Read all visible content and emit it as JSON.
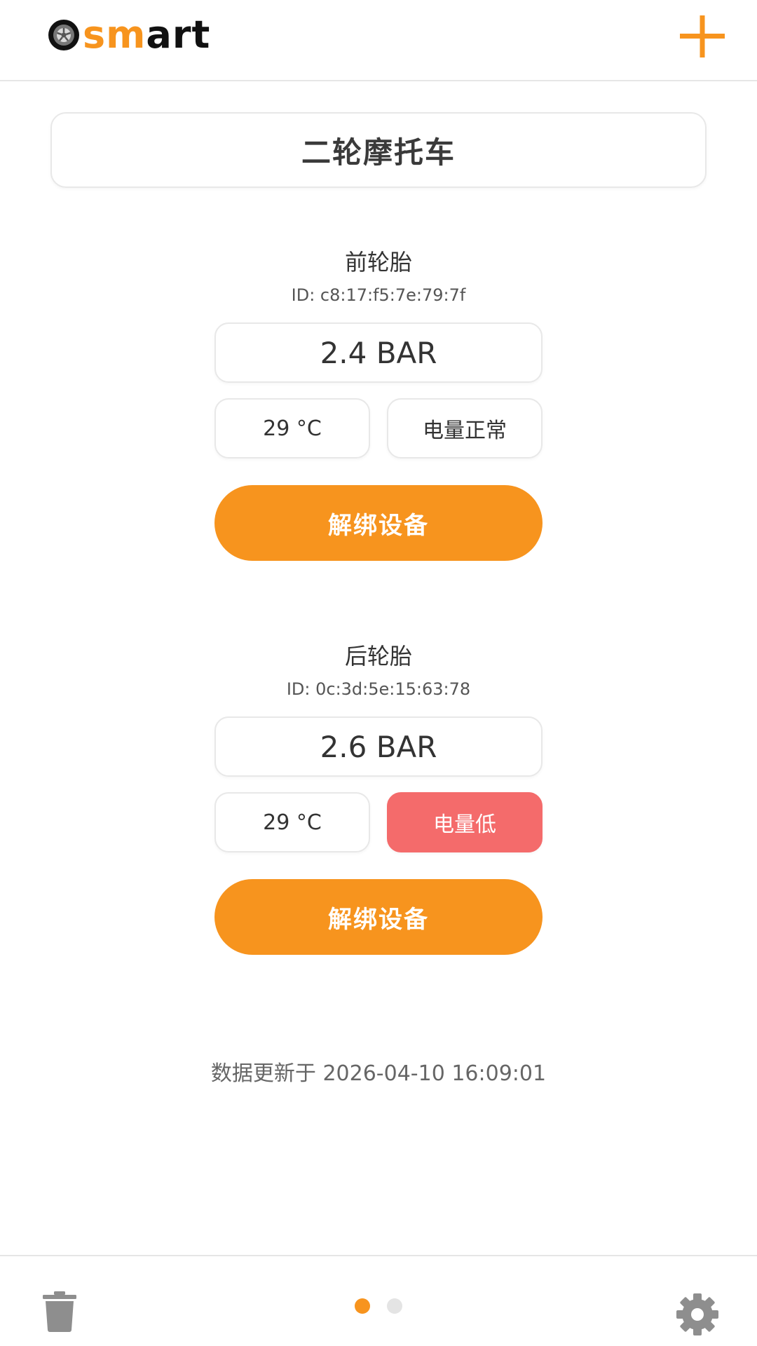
{
  "header": {
    "logo_text_orange": "sm",
    "logo_text_dark": "art",
    "logo_icon": "tire-icon",
    "add_icon": "plus-icon"
  },
  "vehicle": {
    "name": "二轮摩托车"
  },
  "tires": [
    {
      "title": "前轮胎",
      "id": "ID: c8:17:f5:7e:79:7f",
      "pressure": "2.4 BAR",
      "temperature": "29 °C",
      "battery": "电量正常",
      "battery_status": "normal",
      "unbind_label": "解绑设备"
    },
    {
      "title": "后轮胎",
      "id": "ID: 0c:3d:5e:15:63:78",
      "pressure": "2.6 BAR",
      "temperature": "29 °C",
      "battery": "电量低",
      "battery_status": "low",
      "unbind_label": "解绑设备"
    }
  ],
  "footer": {
    "update_text": "数据更新于 2026-04-10 16:09:01",
    "trash_icon": "trash-icon",
    "settings_icon": "gear-icon",
    "page_count": 2,
    "current_page": 1
  },
  "colors": {
    "accent": "#f7941e",
    "battery_low": "#f46b6b",
    "border": "#e8e8e8",
    "icon_gray": "#8e8e8e"
  }
}
